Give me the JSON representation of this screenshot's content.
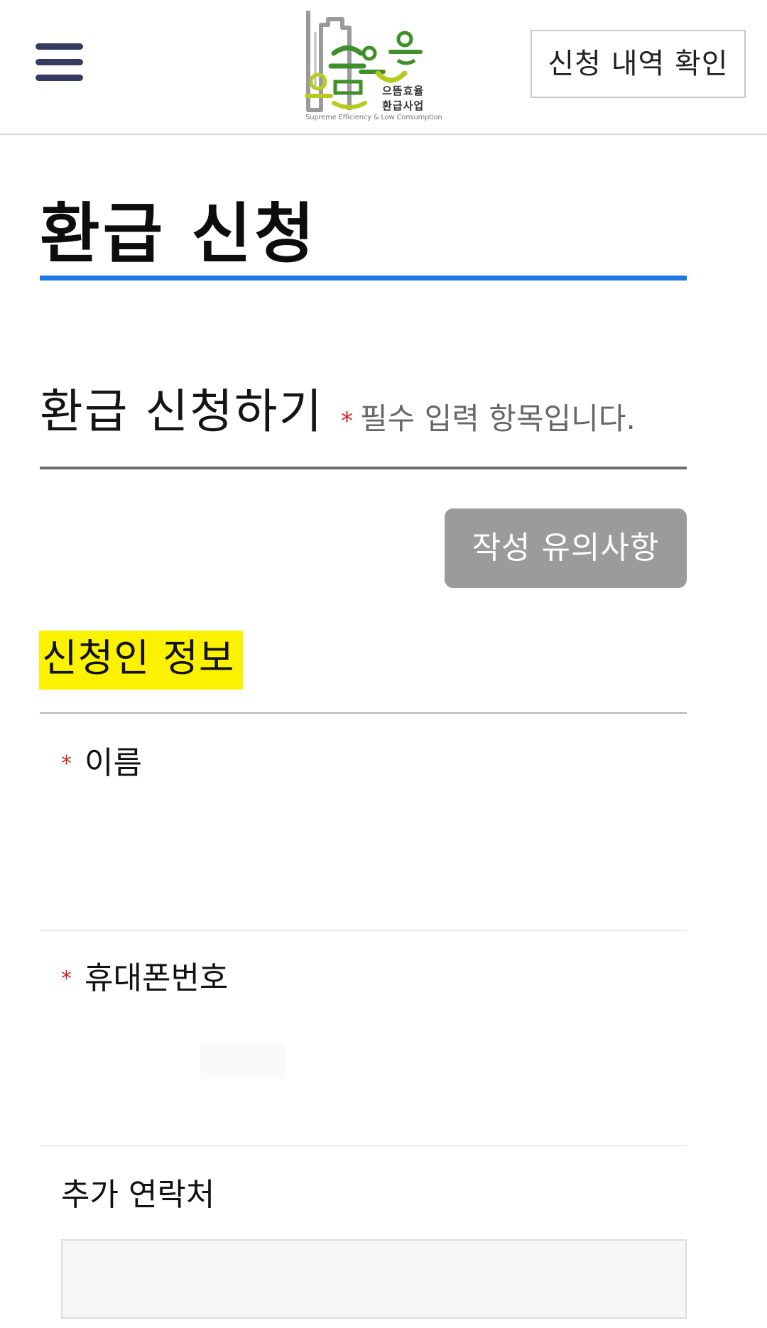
{
  "header": {
    "menu_icon": "hamburger-menu-icon",
    "logo": {
      "name_line1": "으뜸효율",
      "name_line2": "환급사업",
      "tagline": "Supreme Efficiency & Low Consumption",
      "colors": {
        "green": "#3f8f2a",
        "lime": "#b5cc1f",
        "gray": "#9a9a9a"
      }
    },
    "history_button_label": "신청 내역 확인"
  },
  "page": {
    "title": "환급 신청",
    "accent_color": "#1f78e6"
  },
  "form": {
    "section_title": "환급 신청하기",
    "required_star": "*",
    "required_note": "필수 입력 항목입니다.",
    "guide_button_label": "작성 유의사항",
    "applicant": {
      "heading": "신청인 정보",
      "highlight_color": "#fbf200",
      "fields": [
        {
          "label": "이름",
          "required": true
        },
        {
          "label": "휴대폰번호",
          "required": true
        },
        {
          "label": "추가 연락처",
          "required": false,
          "value": "",
          "placeholder": ""
        }
      ]
    }
  }
}
